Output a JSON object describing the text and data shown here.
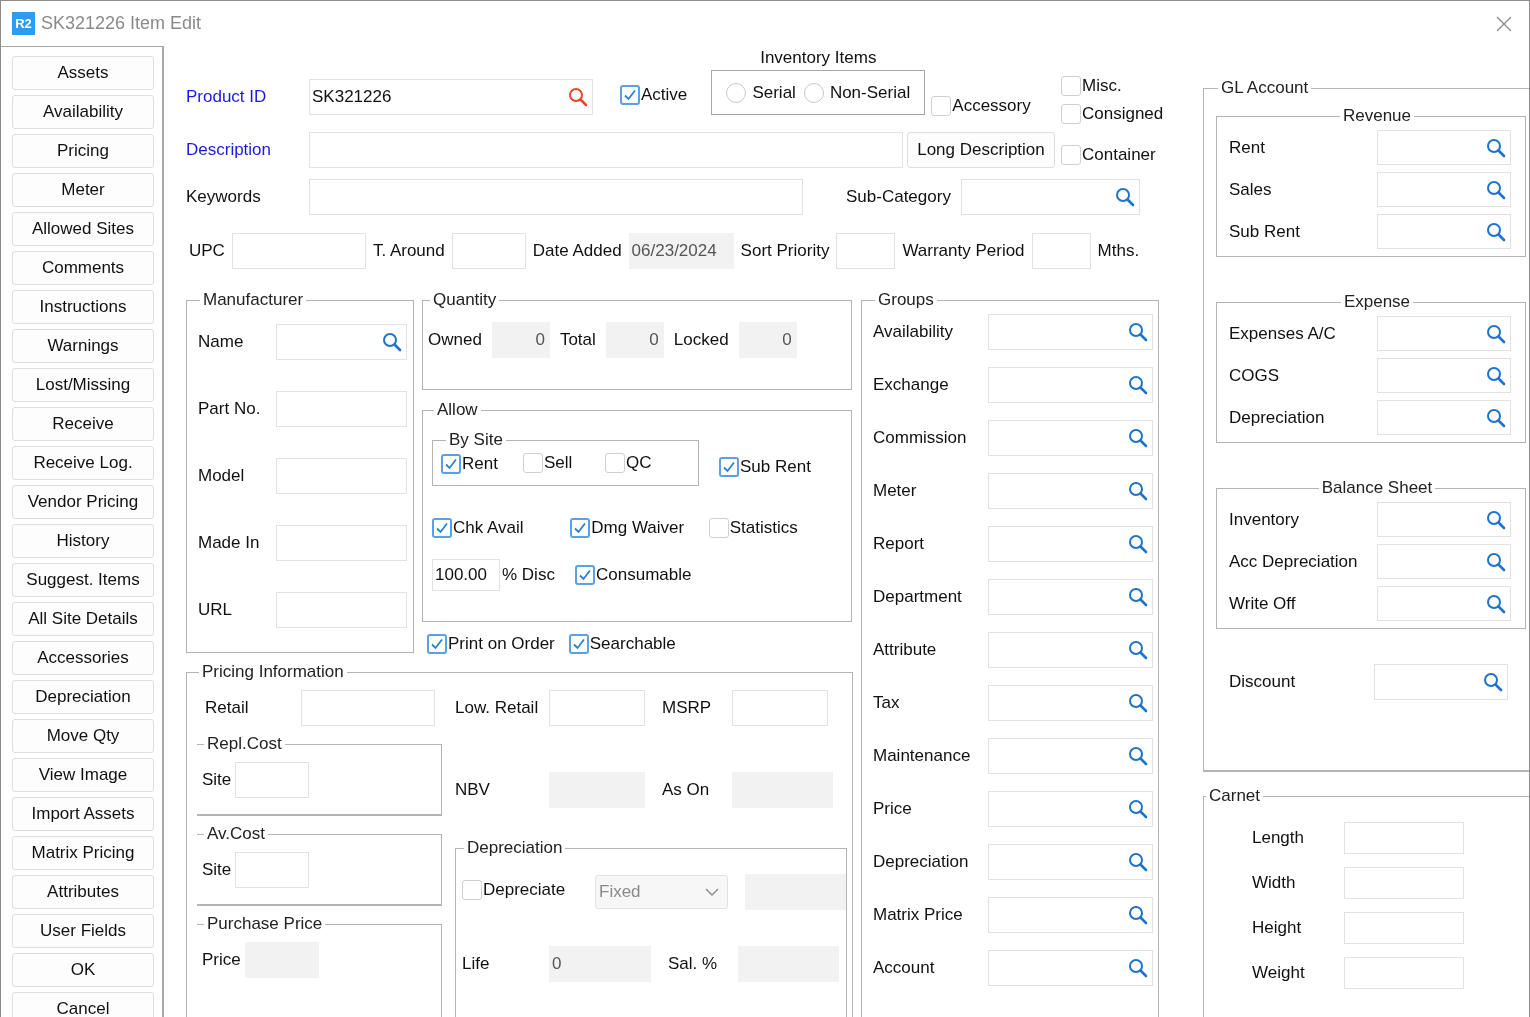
{
  "window": {
    "title": "SK321226 Item Edit",
    "app_badge": "R2"
  },
  "sidebar": {
    "buttons": [
      "Assets",
      "Availability",
      "Pricing",
      "Meter",
      "Allowed Sites",
      "Comments",
      "Instructions",
      "Warnings",
      "Lost/Missing",
      "Receive",
      "Receive Log.",
      "Vendor Pricing",
      "History",
      "Suggest. Items",
      "All Site Details",
      "Accessories",
      "Depreciation",
      "Move Qty",
      "View Image",
      "Import Assets",
      "Matrix Pricing",
      "Attributes",
      "User Fields",
      "OK",
      "Cancel"
    ]
  },
  "header": {
    "product_id": {
      "label": "Product ID",
      "value": "SK321226",
      "lookup": true
    },
    "active": {
      "label": "Active",
      "checked": true
    },
    "inventory_items": {
      "title": "Inventory Items",
      "options": [
        {
          "label": "Serial",
          "selected": false
        },
        {
          "label": "Non-Serial",
          "selected": false
        }
      ]
    },
    "accessory": {
      "label": "Accessory",
      "checked": false
    },
    "flags": [
      {
        "label": "Misc.",
        "checked": false
      },
      {
        "label": "Consigned",
        "checked": false
      },
      {
        "label": "Container",
        "checked": false
      }
    ],
    "description": {
      "label": "Description"
    },
    "long_description_button": "Long Description",
    "keywords": {
      "label": "Keywords"
    },
    "sub_category": {
      "label": "Sub-Category",
      "lookup": true
    },
    "upc_row": [
      {
        "label": "UPC",
        "disabled": false
      },
      {
        "label": "T. Around",
        "disabled": false
      },
      {
        "label": "Date Added",
        "value": "06/23/2024",
        "disabled": true
      },
      {
        "label": "Sort Priority",
        "disabled": false
      },
      {
        "label": "Warranty Period",
        "disabled": false
      }
    ],
    "months_unit": "Mths."
  },
  "manufacturer": {
    "title": "Manufacturer",
    "fields": [
      {
        "label": "Name",
        "lookup": true
      },
      {
        "label": "Part No.",
        "lookup": false
      },
      {
        "label": "Model",
        "lookup": false
      },
      {
        "label": "Made In",
        "lookup": false
      },
      {
        "label": "URL",
        "lookup": false
      }
    ]
  },
  "quantity": {
    "title": "Quantity",
    "fields": [
      {
        "label": "Owned",
        "value": "0"
      },
      {
        "label": "Total",
        "value": "0"
      },
      {
        "label": "Locked",
        "value": "0"
      }
    ]
  },
  "allow": {
    "title": "Allow",
    "by_site": {
      "title": "By Site",
      "options": [
        {
          "label": "Rent",
          "checked": true
        },
        {
          "label": "Sell",
          "checked": false
        },
        {
          "label": "QC",
          "checked": false
        }
      ]
    },
    "sub_rent": {
      "label": "Sub Rent",
      "checked": true
    },
    "options": [
      {
        "label": "Chk Avail",
        "checked": true
      },
      {
        "label": "Dmg Waiver",
        "checked": true
      },
      {
        "label": "Statistics",
        "checked": false
      }
    ],
    "discount": {
      "value": "100.00",
      "label": "% Disc"
    },
    "consumable": {
      "label": "Consumable",
      "checked": true
    }
  },
  "print_options": [
    {
      "label": "Print on Order",
      "checked": true
    },
    {
      "label": "Searchable",
      "checked": true
    }
  ],
  "pricing": {
    "title": "Pricing Information",
    "retail": {
      "label": "Retail"
    },
    "low_retail": {
      "label": "Low. Retail"
    },
    "msrp": {
      "label": "MSRP"
    },
    "repl_cost": {
      "title": "Repl.Cost",
      "site_label": "Site"
    },
    "av_cost": {
      "title": "Av.Cost",
      "site_label": "Site"
    },
    "purchase_price": {
      "title": "Purchase Price",
      "price_label": "Price"
    },
    "nbv": {
      "label": "NBV"
    },
    "as_on": {
      "label": "As On"
    },
    "depreciation": {
      "title": "Depreciation",
      "depreciate": {
        "label": "Depreciate",
        "checked": false
      },
      "method": {
        "value": "Fixed",
        "disabled": true
      },
      "life": {
        "label": "Life",
        "value": "0"
      },
      "salvage": {
        "label": "Sal. %"
      }
    }
  },
  "groups": {
    "title": "Groups",
    "fields": [
      "Availability",
      "Exchange",
      "Commission",
      "Meter",
      "Report",
      "Department",
      "Attribute",
      "Tax",
      "Maintenance",
      "Price",
      "Depreciation",
      "Matrix Price",
      "Account"
    ]
  },
  "gl_account": {
    "title": "GL Account",
    "sections": [
      {
        "title": "Revenue",
        "fields": [
          "Rent",
          "Sales",
          "Sub Rent"
        ]
      },
      {
        "title": "Expense",
        "fields": [
          "Expenses A/C",
          "COGS",
          "Depreciation"
        ]
      },
      {
        "title": "Balance Sheet",
        "fields": [
          "Inventory",
          "Acc Depreciation",
          "Write Off"
        ]
      }
    ],
    "discount": {
      "label": "Discount"
    }
  },
  "carnet": {
    "title": "Carnet",
    "fields": [
      "Length",
      "Width",
      "Height",
      "Weight"
    ]
  }
}
